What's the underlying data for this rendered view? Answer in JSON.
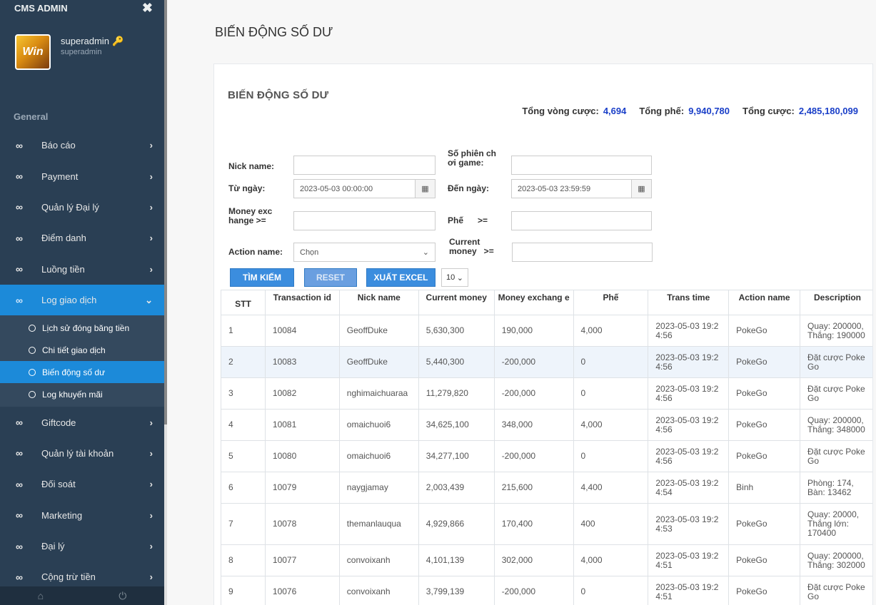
{
  "sidebar": {
    "title": "CMS ADMIN",
    "avatar_text": "Win",
    "profile": {
      "name": "superadmin",
      "sub": "superadmin"
    },
    "section": "General",
    "items": [
      {
        "label": "Báo cáo",
        "icon": "infinity-icon"
      },
      {
        "label": "Payment",
        "icon": "infinity-icon"
      },
      {
        "label": "Quản lý Đại lý",
        "icon": "infinity-icon"
      },
      {
        "label": "Điểm danh",
        "icon": "infinity-icon"
      },
      {
        "label": "Luồng tiền",
        "icon": "infinity-icon"
      },
      {
        "label": "Log giao dịch",
        "icon": "infinity-icon",
        "active": true
      },
      {
        "label": "Giftcode",
        "icon": "infinity-icon"
      },
      {
        "label": "Quản lý tài khoản",
        "icon": "infinity-icon"
      },
      {
        "label": "Đối soát",
        "icon": "infinity-icon"
      },
      {
        "label": "Marketing",
        "icon": "infinity-icon"
      },
      {
        "label": "Đại lý",
        "icon": "infinity-icon"
      },
      {
        "label": "Cộng trừ tiền",
        "icon": "infinity-icon"
      }
    ],
    "subitems": [
      {
        "label": "Lịch sử đóng băng tiền"
      },
      {
        "label": "Chi tiết giao dịch"
      },
      {
        "label": "Biến động số dư",
        "active": true
      },
      {
        "label": "Log khuyến mãi"
      }
    ]
  },
  "page": {
    "title": "BIẾN ĐỘNG SỐ DƯ"
  },
  "panel": {
    "title": "BIẾN ĐỘNG SỐ DƯ",
    "totals": {
      "vong_label": "Tổng vòng cược:",
      "vong_value": "4,694",
      "phe_label": "Tổng phế:",
      "phe_value": "9,940,780",
      "cuoc_label": "Tổng cược:",
      "cuoc_value": "2,485,180,099"
    }
  },
  "filters": {
    "nickname_label": "Nick name:",
    "session_label_1": "Số phiên ch",
    "session_label_2": "ơi game:",
    "from_label": "Từ ngày:",
    "from_value": "2023-05-03 00:00:00",
    "to_label": "Đến ngày:",
    "to_value": "2023-05-03 23:59:59",
    "money_label_1": "Money exc",
    "money_label_2": "hange  >=",
    "phe_label": "Phế      >=",
    "action_label": "Action name:",
    "action_value": "Chọn",
    "current_label_1": "Current",
    "current_label_2": "money   >="
  },
  "buttons": {
    "search": "TÌM KIẾM",
    "reset": "RESET",
    "excel": "XUẤT EXCEL",
    "pagesize": "10"
  },
  "table": {
    "headers": [
      "STT",
      "Transaction id",
      "Nick name",
      "Current money",
      "Money exchang e",
      "Phế",
      "Trans time",
      "Action name",
      "Description"
    ],
    "rows": [
      {
        "stt": "1",
        "tid": "10084",
        "nick": "GeoffDuke",
        "current": "5,630,300",
        "exchange": "190,000",
        "phe": "4,000",
        "time": "2023-05-03 19:2 4:56",
        "action": "PokeGo",
        "desc": "Quay: 200000, Thắng: 190000"
      },
      {
        "stt": "2",
        "tid": "10083",
        "nick": "GeoffDuke",
        "current": "5,440,300",
        "exchange": "-200,000",
        "phe": "0",
        "time": "2023-05-03 19:2 4:56",
        "action": "PokeGo",
        "desc": "Đặt cược Poke Go"
      },
      {
        "stt": "3",
        "tid": "10082",
        "nick": "nghimaichuaraa",
        "current": "11,279,820",
        "exchange": "-200,000",
        "phe": "0",
        "time": "2023-05-03 19:2 4:56",
        "action": "PokeGo",
        "desc": "Đặt cược Poke Go"
      },
      {
        "stt": "4",
        "tid": "10081",
        "nick": "omaichuoi6",
        "current": "34,625,100",
        "exchange": "348,000",
        "phe": "4,000",
        "time": "2023-05-03 19:2 4:56",
        "action": "PokeGo",
        "desc": "Quay: 200000, Thắng: 348000"
      },
      {
        "stt": "5",
        "tid": "10080",
        "nick": "omaichuoi6",
        "current": "34,277,100",
        "exchange": "-200,000",
        "phe": "0",
        "time": "2023-05-03 19:2 4:56",
        "action": "PokeGo",
        "desc": "Đặt cược Poke Go"
      },
      {
        "stt": "6",
        "tid": "10079",
        "nick": "naygjamay",
        "current": "2,003,439",
        "exchange": "215,600",
        "phe": "4,400",
        "time": "2023-05-03 19:2 4:54",
        "action": "Binh",
        "desc": "Phòng: 174, Bàn: 13462"
      },
      {
        "stt": "7",
        "tid": "10078",
        "nick": "themanlauqua",
        "current": "4,929,866",
        "exchange": "170,400",
        "phe": "400",
        "time": "2023-05-03 19:2 4:53",
        "action": "PokeGo",
        "desc": "Quay: 20000, Thắng lớn: 170400"
      },
      {
        "stt": "8",
        "tid": "10077",
        "nick": "convoixanh",
        "current": "4,101,139",
        "exchange": "302,000",
        "phe": "4,000",
        "time": "2023-05-03 19:2 4:51",
        "action": "PokeGo",
        "desc": "Quay: 200000, Thắng: 302000"
      },
      {
        "stt": "9",
        "tid": "10076",
        "nick": "convoixanh",
        "current": "3,799,139",
        "exchange": "-200,000",
        "phe": "0",
        "time": "2023-05-03 19:2 4:51",
        "action": "PokeGo",
        "desc": "Đặt cược Poke Go"
      }
    ]
  },
  "colors": {
    "sidebar_bg": "#2a3f54",
    "active_blue": "#1c8ad9",
    "button_blue": "#3b8dde",
    "total_value": "#1a3fc8"
  }
}
